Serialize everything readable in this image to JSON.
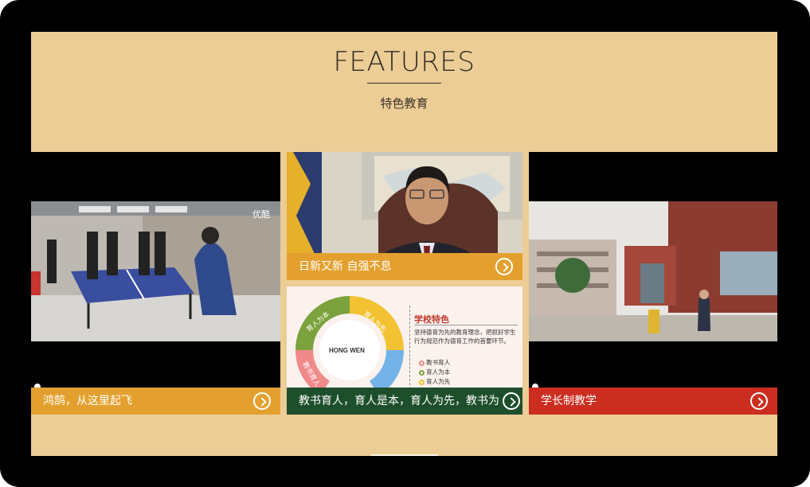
{
  "header": {
    "title": "FEATURES",
    "subtitle": "特色教育"
  },
  "cards": [
    {
      "caption": "鸿鹄，从这里起飞",
      "color": "#e4a02f",
      "watermark": "优酷",
      "icon": "chevron-right-circle-icon"
    },
    {
      "caption": "日新又新 自强不息",
      "color": "#e4a02f",
      "icon": "chevron-right-circle-icon"
    },
    {
      "caption": "教书育人，育人是本，育人为先，教书为",
      "color": "#1e4f2c",
      "icon": "chevron-right-circle-icon",
      "diagram": {
        "center": "HONG WEN",
        "segments": [
          "育人为本",
          "育人为先",
          "教书育人"
        ],
        "heading": "学校特色",
        "body": [
          "坚持德育为先的教育理念，把抓好学生",
          "行为规范作为德育工作的首要环节。"
        ],
        "legend": [
          "教书育人",
          "育人为本",
          "育人为先"
        ]
      }
    },
    {
      "caption": "学长制教学",
      "color": "#cc2d21",
      "icon": "chevron-right-circle-icon"
    }
  ],
  "colors": {
    "background": "#eccd96",
    "frame": "#000000",
    "accent_orange": "#e4a02f",
    "accent_green": "#1e4f2c",
    "accent_red": "#cc2d21"
  }
}
